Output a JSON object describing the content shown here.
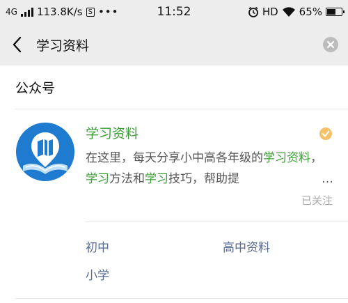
{
  "status": {
    "network": "4G",
    "speed": "113.8K/s",
    "s_badge": "S",
    "more": "•••",
    "time": "11:52",
    "hd": "HD",
    "battery_text": "65%",
    "battery_level": 0.65
  },
  "search": {
    "query": "学习资料",
    "back_icon": "chevron-left-icon",
    "clear_icon": "clear-circle-icon"
  },
  "section": {
    "title": "公众号"
  },
  "account": {
    "name": "学习资料",
    "desc": [
      {
        "t": "在这里，每天分享小中高各年级的",
        "hl": false
      },
      {
        "t": "学习",
        "hl": true
      },
      {
        "t": "资料",
        "hl": true
      },
      {
        "t": "，",
        "hl": false
      },
      {
        "t": "学习",
        "hl": true
      },
      {
        "t": "方法和",
        "hl": false
      },
      {
        "t": "学习",
        "hl": true
      },
      {
        "t": "技巧，帮助提",
        "hl": false
      }
    ],
    "ellipsis": "…",
    "followed": "已关注",
    "highlight_color": "#3a9e34",
    "logo_colors": {
      "blue": "#1f7bd0",
      "light": "#bfe0f7"
    }
  },
  "menu": {
    "items": [
      "初中",
      "高中资料",
      "小学"
    ],
    "link_color": "#576b95"
  }
}
